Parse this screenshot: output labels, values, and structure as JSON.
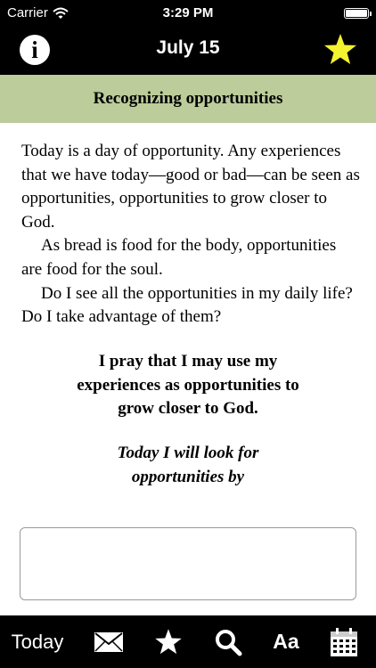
{
  "status_bar": {
    "carrier": "Carrier",
    "time": "3:29 PM"
  },
  "nav": {
    "info_icon": "i",
    "title": "July 15",
    "favorite_icon": "star-icon"
  },
  "section": {
    "title": "Recognizing opportunities"
  },
  "reading": {
    "paragraphs": [
      "Today is a day of opportunity. Any experiences that we have today—good or bad—can be seen as opportunities, opportunities to grow closer to God.",
      "As bread is food for the body, opportunities are food for the soul.",
      "Do I see all the opportunities in my daily life? Do I take advantage of them?"
    ]
  },
  "prayer": {
    "lines": [
      "I pray that I may use my",
      "experiences as opportunities to",
      "grow closer to God."
    ]
  },
  "resolution": {
    "lines": [
      "Today I will look for",
      "opportunities by"
    ]
  },
  "journal": {
    "value": "",
    "placeholder": ""
  },
  "tabs": {
    "today_label": "Today",
    "font_label": "Aa",
    "icons": [
      "mail-icon",
      "star-icon",
      "search-icon",
      "font-size-icon",
      "calendar-icon"
    ]
  },
  "colors": {
    "bar_background": "#000000",
    "section_background": "#bccc9a",
    "favorite_star": "#f3f32f"
  }
}
